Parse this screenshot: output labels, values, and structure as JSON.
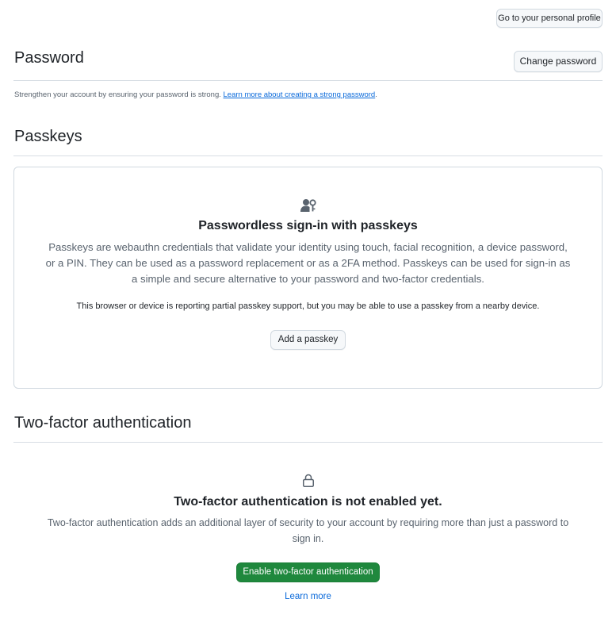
{
  "header": {
    "profile_button": "Go to your personal profile"
  },
  "password": {
    "title": "Password",
    "change_button": "Change password",
    "description": "Strengthen your account by ensuring your password is strong.",
    "learn_link": "Learn more about creating a strong password",
    "trailing": "."
  },
  "passkeys": {
    "title": "Passkeys",
    "icon": "person-key-icon",
    "heading": "Passwordless sign-in with passkeys",
    "description": "Passkeys are webauthn credentials that validate your identity using touch, facial recognition, a device password, or a PIN. They can be used as a password replacement or as a 2FA method. Passkeys can be used for sign-in as a simple and secure alternative to your password and two-factor credentials.",
    "support_note": "This browser or device is reporting partial passkey support, but you may be able to use a passkey from a nearby device.",
    "add_button": "Add a passkey"
  },
  "two_factor": {
    "title": "Two-factor authentication",
    "icon": "lock-icon",
    "heading": "Two-factor authentication is not enabled yet.",
    "description": "Two-factor authentication adds an additional layer of security to your account by requiring more than just a password to sign in.",
    "enable_button": "Enable two-factor authentication",
    "learn_more": "Learn more"
  },
  "colors": {
    "primary_button": "#1f883d",
    "link": "#0969da",
    "muted_text": "#59636e",
    "border": "#d1d9e0"
  }
}
